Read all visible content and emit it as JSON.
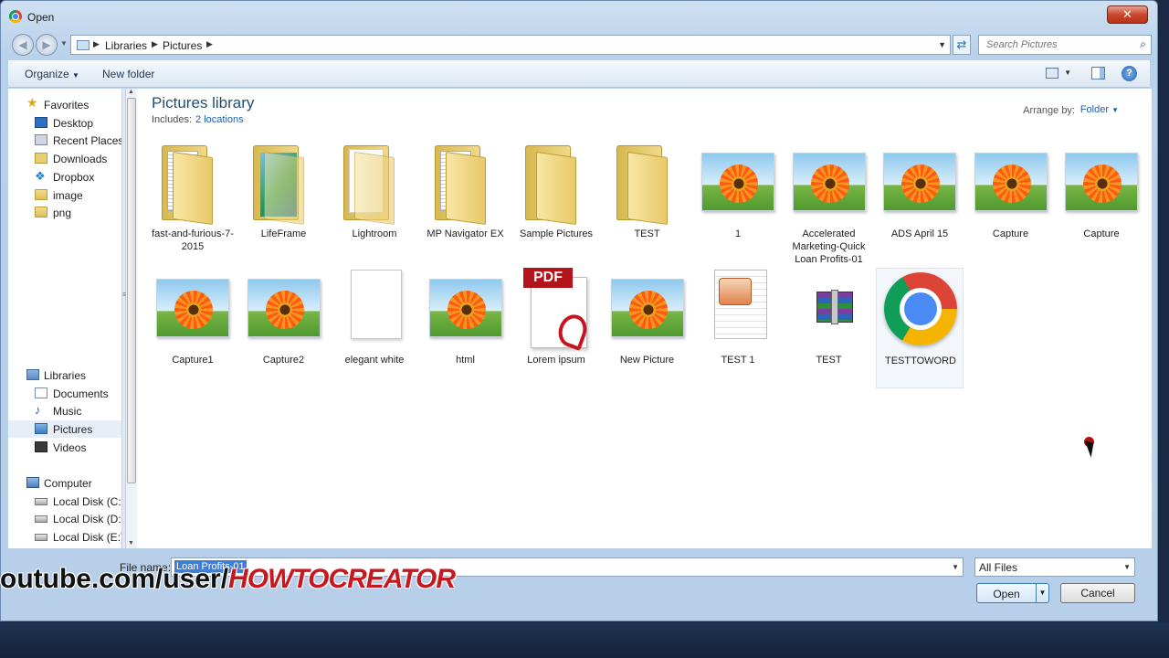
{
  "window": {
    "title": "Open",
    "close_glyph": "✕"
  },
  "address": {
    "crumbs": [
      "Libraries",
      "Pictures"
    ],
    "search_placeholder": "Search Pictures"
  },
  "toolbar": {
    "organize": "Organize",
    "new_folder": "New folder",
    "help": "?"
  },
  "sidebar": {
    "favorites": [
      {
        "label": "Favorites",
        "icon": "star-icon"
      },
      {
        "label": "Desktop",
        "icon": "desktop-icon"
      },
      {
        "label": "Recent Places",
        "icon": "recent-places-icon"
      },
      {
        "label": "Downloads",
        "icon": "downloads-icon"
      },
      {
        "label": "Dropbox",
        "icon": "dropbox-icon"
      },
      {
        "label": "image",
        "icon": "folder-icon"
      },
      {
        "label": "png",
        "icon": "folder-icon"
      }
    ],
    "libraries": [
      {
        "label": "Libraries",
        "icon": "libraries-icon"
      },
      {
        "label": "Documents",
        "icon": "documents-icon"
      },
      {
        "label": "Music",
        "icon": "music-icon"
      },
      {
        "label": "Pictures",
        "icon": "pictures-icon",
        "selected": true
      },
      {
        "label": "Videos",
        "icon": "videos-icon"
      }
    ],
    "computer": [
      {
        "label": "Computer",
        "icon": "computer-icon"
      },
      {
        "label": "Local Disk (C:)",
        "icon": "disk-icon"
      },
      {
        "label": "Local Disk (D:)",
        "icon": "disk-icon"
      },
      {
        "label": "Local Disk (E:)",
        "icon": "disk-icon"
      }
    ]
  },
  "library": {
    "title": "Pictures library",
    "includes_label": "Includes:",
    "includes_link": "2 locations",
    "arrange_label": "Arrange by:",
    "arrange_value": "Folder"
  },
  "files": [
    {
      "name": "fast-and-furious-7-2015",
      "kind": "folder-docs"
    },
    {
      "name": "LifeFrame",
      "kind": "folder-blue"
    },
    {
      "name": "Lightroom",
      "kind": "folder-white"
    },
    {
      "name": "MP Navigator EX",
      "kind": "folder-docs"
    },
    {
      "name": "Sample Pictures",
      "kind": "folder"
    },
    {
      "name": "TEST",
      "kind": "folder"
    },
    {
      "name": "1",
      "kind": "image"
    },
    {
      "name": "Accelerated Marketing-Quick Loan Profits-01",
      "kind": "image"
    },
    {
      "name": "ADS April 15",
      "kind": "image"
    },
    {
      "name": "Capture",
      "kind": "image"
    },
    {
      "name": "Capture",
      "kind": "image"
    },
    {
      "name": "Capture1",
      "kind": "image"
    },
    {
      "name": "Capture2",
      "kind": "image"
    },
    {
      "name": "elegant white",
      "kind": "blank"
    },
    {
      "name": "html",
      "kind": "image"
    },
    {
      "name": "Lorem ipsum",
      "kind": "pdf",
      "badge": "PDF"
    },
    {
      "name": "New Picture",
      "kind": "image"
    },
    {
      "name": "TEST 1",
      "kind": "ppt"
    },
    {
      "name": "TEST",
      "kind": "rar"
    },
    {
      "name": "TESTTOWORD",
      "kind": "chrome",
      "hovered": true
    }
  ],
  "bottom": {
    "file_name_label": "File name:",
    "file_name_value": "Loan Profits-01",
    "filter_value": "All Files",
    "open_label": "Open",
    "cancel_label": "Cancel"
  },
  "watermark": {
    "url": "outube.com/user/",
    "brand": "HOWTOCREATOR"
  }
}
